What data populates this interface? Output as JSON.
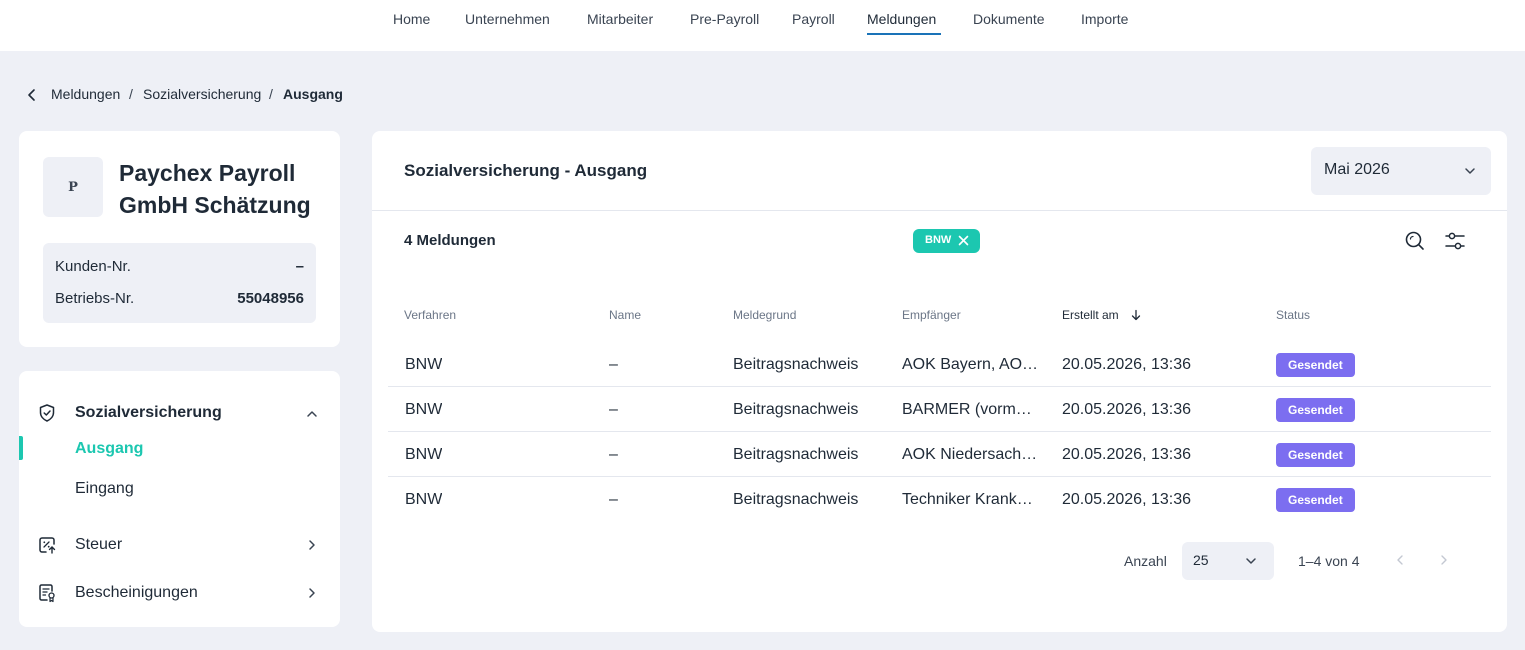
{
  "nav": {
    "items": [
      {
        "label": "Home"
      },
      {
        "label": "Unternehmen"
      },
      {
        "label": "Mitarbeiter"
      },
      {
        "label": "Pre-Payroll"
      },
      {
        "label": "Payroll"
      },
      {
        "label": "Meldungen",
        "active": true
      },
      {
        "label": "Dokumente"
      },
      {
        "label": "Importe"
      }
    ]
  },
  "breadcrumb": {
    "items": [
      "Meldungen",
      "Sozialversicherung"
    ],
    "current": "Ausgang"
  },
  "company": {
    "avatar_letter": "P",
    "name": "Paychex Payroll GmbH Schätzung",
    "kunden_label": "Kunden-Nr.",
    "kunden_value": "–",
    "betriebs_label": "Betriebs-Nr.",
    "betriebs_value": "55048956"
  },
  "menu": {
    "sozialversicherung": "Sozialversicherung",
    "ausgang": "Ausgang",
    "eingang": "Eingang",
    "steuer": "Steuer",
    "bescheinigungen": "Bescheinigungen"
  },
  "main": {
    "title": "Sozialversicherung - Ausgang",
    "month": "Mai 2026",
    "count": "4 Meldungen",
    "filter_chip": "BNW",
    "columns": {
      "verfahren": "Verfahren",
      "name": "Name",
      "meldegrund": "Meldegrund",
      "empfaenger": "Empfänger",
      "erstellt": "Erstellt am",
      "status": "Status"
    },
    "rows": [
      {
        "verfahren": "BNW",
        "name": "–",
        "meldegrund": "Beitragsnachweis",
        "empfaenger": "AOK Bayern, AO…",
        "erstellt": "20.05.2026, 13:36",
        "status": "Gesendet"
      },
      {
        "verfahren": "BNW",
        "name": "–",
        "meldegrund": "Beitragsnachweis",
        "empfaenger": "BARMER (vorm…",
        "erstellt": "20.05.2026, 13:36",
        "status": "Gesendet"
      },
      {
        "verfahren": "BNW",
        "name": "–",
        "meldegrund": "Beitragsnachweis",
        "empfaenger": "AOK Niedersach…",
        "erstellt": "20.05.2026, 13:36",
        "status": "Gesendet"
      },
      {
        "verfahren": "BNW",
        "name": "–",
        "meldegrund": "Beitragsnachweis",
        "empfaenger": "Techniker Krank…",
        "erstellt": "20.05.2026, 13:36",
        "status": "Gesendet"
      }
    ],
    "pagination": {
      "label": "Anzahl",
      "page_size": "25",
      "range": "1–4 von 4"
    }
  },
  "colors": {
    "accent": "#1cc7b0",
    "status_badge": "#7c6ef0",
    "nav_underline": "#1a73b8",
    "background": "#eef0f6"
  },
  "icons": [
    "chevron-left-icon",
    "shield-icon",
    "chevron-up-icon",
    "tax-icon",
    "chevron-right-icon",
    "certificate-icon",
    "chevron-down-icon",
    "close-icon",
    "search-icon",
    "filter-sliders-icon",
    "sort-arrow-down-icon"
  ]
}
